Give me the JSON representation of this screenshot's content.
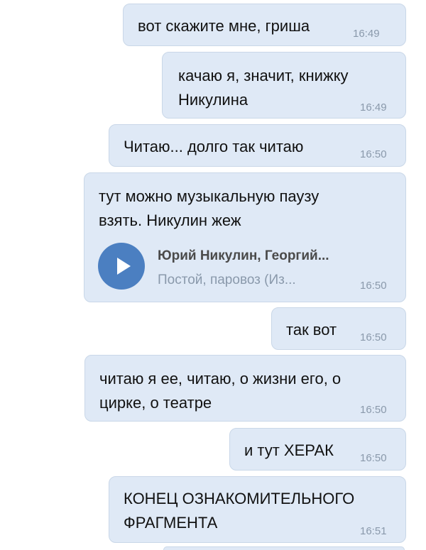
{
  "messages": [
    {
      "text": "вот скажите мне, гриша",
      "time": "16:49"
    },
    {
      "lines": [
        "качаю я, значит, книжку",
        "Никулина"
      ],
      "time": "16:49"
    },
    {
      "text": "Читаю... долго так читаю",
      "time": "16:50"
    },
    {
      "lines": [
        "тут можно музыкальную паузу",
        "взять. Никулин жеж"
      ],
      "time": "16:50",
      "audio": {
        "icon": "play-icon",
        "title": "Юрий Никулин, Георгий...",
        "subtitle": "Постой, паровоз (Из..."
      }
    },
    {
      "text": "так вот",
      "time": "16:50"
    },
    {
      "lines": [
        "читаю я ее, читаю, о жизни его, о",
        "цирке, о театре"
      ],
      "time": "16:50"
    },
    {
      "text": "и тут ХЕРАК",
      "time": "16:50"
    },
    {
      "lines": [
        "КОНЕЦ ОЗНАКОМИТЕЛЬНОГО",
        "ФРАГМЕНТА"
      ],
      "time": "16:51"
    }
  ],
  "colors": {
    "bubble": "#dfe9f6",
    "bubble_border": "#c9d7e8",
    "time": "#8a99ab",
    "play_button": "#4b7fc1"
  }
}
